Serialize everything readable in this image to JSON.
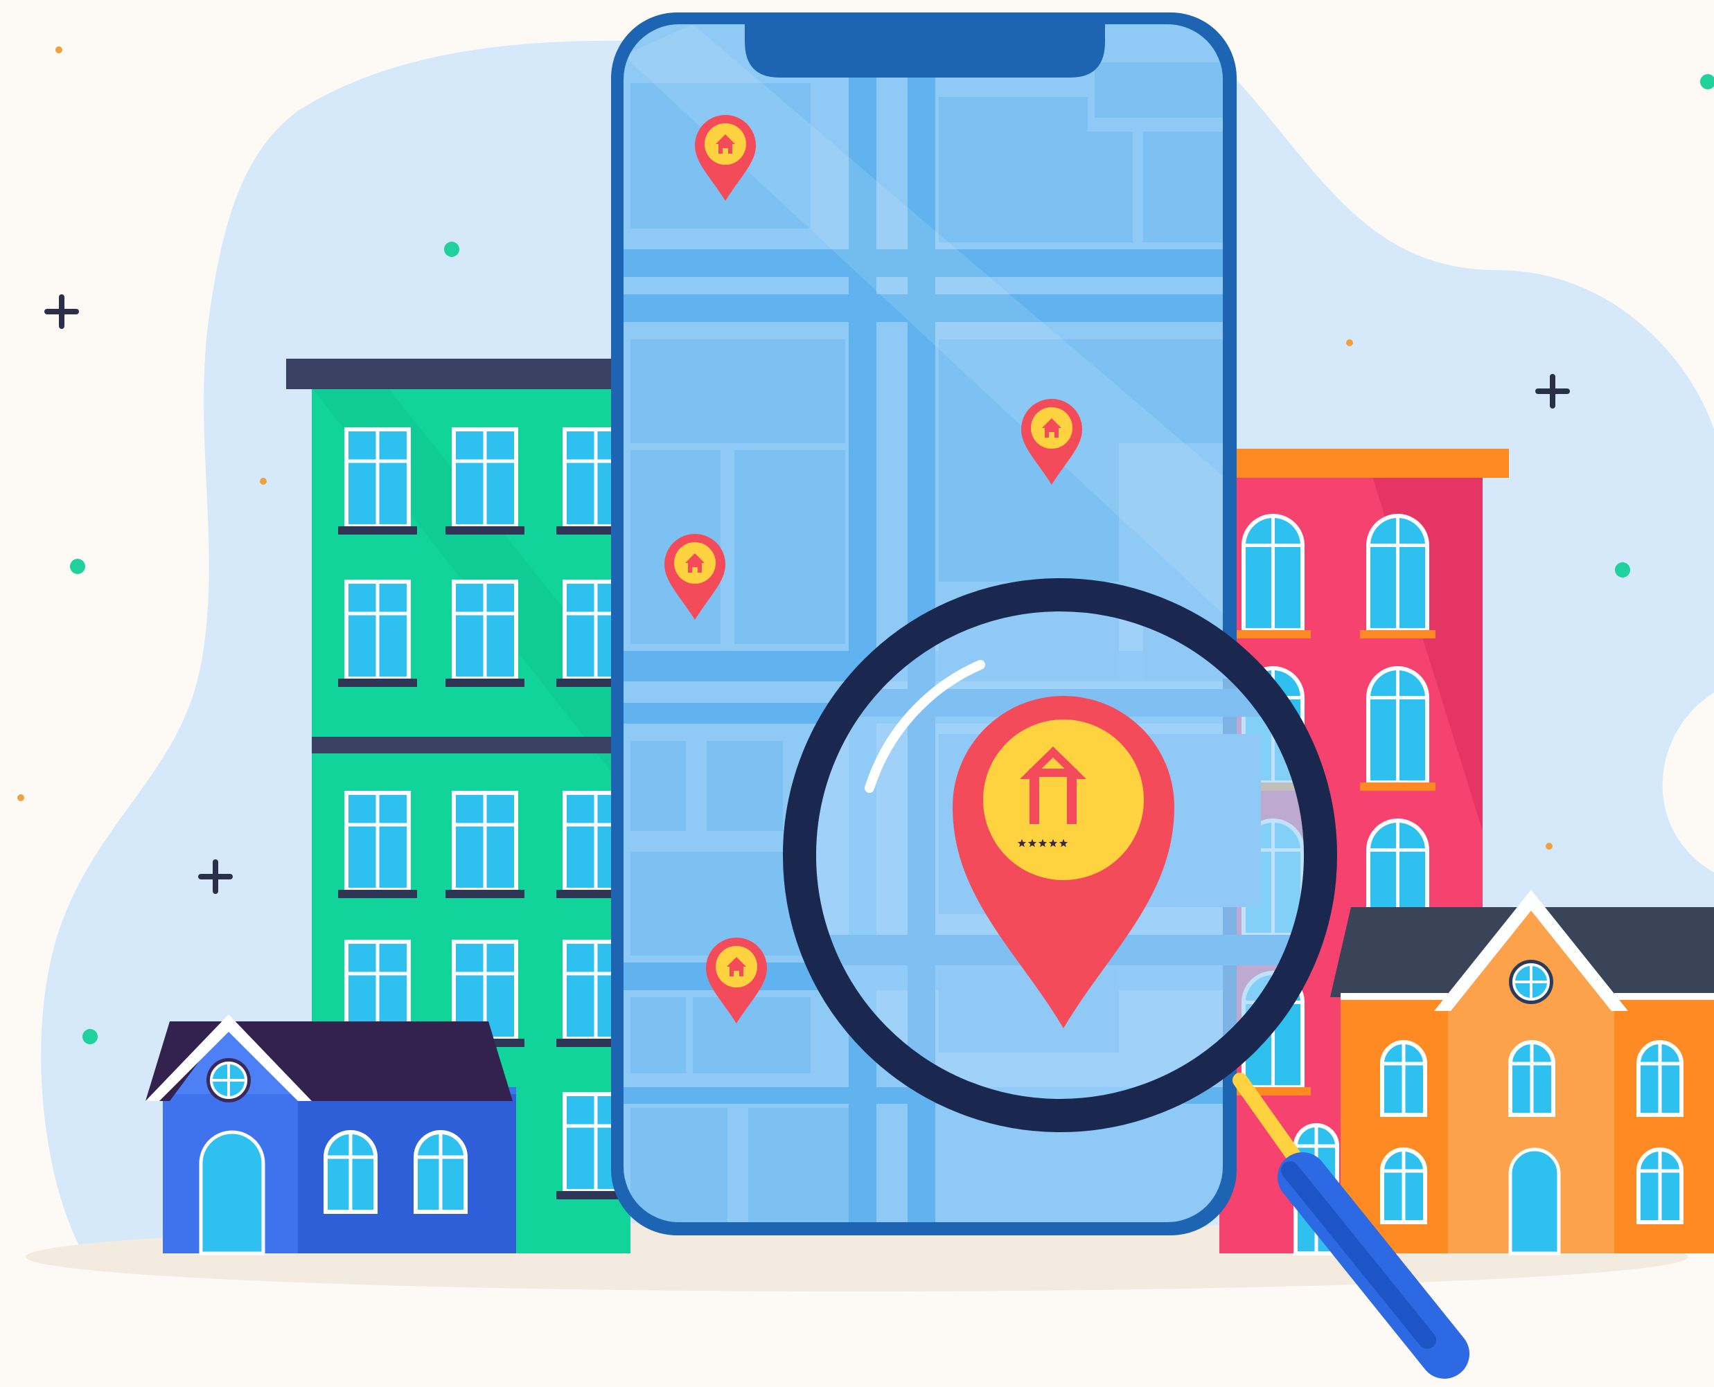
{
  "scene": {
    "colors": {
      "background": "#fdfaf6",
      "backdrop_blob": "#d6e9fb",
      "ground_shadow": "#f3ebe0",
      "phone_frame": "#1d64b3",
      "phone_screen": "#8fc9f5",
      "map_road": "#60b3ee",
      "map_block": "#7dc1f3",
      "green_building": "#11d49b",
      "pink_building": "#f5426f",
      "blue_house": "#3f73ee",
      "orange_house": "#fd8a22",
      "pin_red": "#f44b5a",
      "pin_yellow": "#ffd23f",
      "magnifier_ring": "#1a2850",
      "magnifier_handle": "#2d69e2"
    },
    "icons": [
      "small-location-pin-icon",
      "large-location-pin-icon",
      "house-icon",
      "rating-stars-icon",
      "magnifying-glass-icon",
      "sparkle-plus-icon"
    ],
    "featured_pin": {
      "rating_stars": 5
    }
  }
}
